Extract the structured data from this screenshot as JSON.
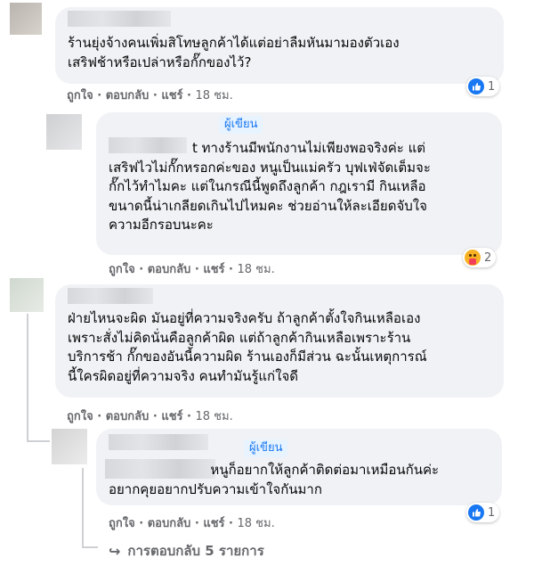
{
  "comments": [
    {
      "text_lines": [
        "ร้านยุ่งจ้างคนเพิ่มสิโทษลูกค้าได้แต่อย่าลืมหันมามองตัวเอง",
        "เสริฟช้าหรือเปล่าหรือกั๊กของไว้?"
      ],
      "actions": {
        "like": "ถูกใจ",
        "reply": "ตอบกลับ",
        "share": "แชร์",
        "time": "18 ชม."
      },
      "reaction": {
        "icon": "like-icon",
        "count": "1"
      }
    },
    {
      "author_badge": "ผู้เขียน",
      "text_lines": [
        "t ทางร้านมีพนักงานไม่เพียงพอจริงค่ะ แต่",
        "เสริฟไวไม่กั๊กหรอกค่ะของ หนูเป็นแม่ครัว บุฟเฟ่จัดเต็มจะ",
        "กั๊กไว้ทำไมคะ แต่ในกรณีนี้พูดถึงลูกค้า กฎเรามี กินเหลือ",
        "ขนาดนี้น่าเกลียดเกินไปไหมคะ ช่วยอ่านให้ละเอียดจับใจ",
        "ความอีกรอบนะคะ"
      ],
      "actions": {
        "like": "ถูกใจ",
        "reply": "ตอบกลับ",
        "share": "แชร์",
        "time": "18 ชม."
      },
      "reaction": {
        "icon": "care-icon",
        "count": "2"
      }
    },
    {
      "text_lines": [
        "ฝ่ายไหนจะผิด มันอยู่ที่ความจริงครับ ถ้าลูกค้าตั้งใจกินเหลือเอง",
        "เพราะสั่งไม่คิดนั่นคือลูกค้าผิด แต่ถ้าลูกค้ากินเหลือเพราะร้าน",
        "บริการช้า กั๊กของอันนี้ความผิด ร้านเองก็มีส่วน ฉะนั้นเหตุการณ์",
        "นี้ใครผิดอยู่ที่ความจริง คนทำมันรู้แก่ใจดี"
      ],
      "actions": {
        "like": "ถูกใจ",
        "reply": "ตอบกลับ",
        "share": "แชร์",
        "time": "18 ชม."
      }
    },
    {
      "author_badge": "ผู้เขียน",
      "text_lines": [
        "                        หนูก็อยากให้ลูกค้าติดต่อมาเหมือนกันค่ะ",
        "อยากคุยอยากปรับความเข้าใจกันมาก"
      ],
      "actions": {
        "like": "ถูกใจ",
        "reply": "ตอบกลับ",
        "share": "แชร์",
        "time": "18 ชม."
      },
      "reaction": {
        "icon": "like-icon",
        "count": "1"
      }
    }
  ],
  "more_replies": {
    "arrow": "↪",
    "label": "การตอบกลับ 5 รายการ"
  },
  "colors": {
    "bubble": "#f0f2f5",
    "link_blue": "#1877f2",
    "meta_gray": "#65676b"
  }
}
